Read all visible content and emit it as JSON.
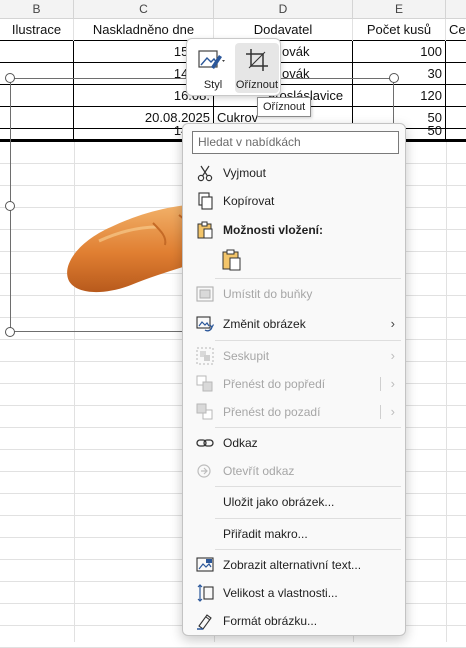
{
  "spreadsheet": {
    "columns": [
      "B",
      "C",
      "D",
      "E"
    ],
    "header_row": [
      "Ilustrace",
      "Naskladněno dne",
      "Dodavatel",
      "Počet kusů",
      "Ce"
    ],
    "rows": [
      {
        "date": "15.08.",
        "supplier": "ovák",
        "count": "100"
      },
      {
        "date": "14.08.",
        "supplier": "ovák",
        "count": "30"
      },
      {
        "date": "16.08.",
        "supplier": "arosláslavice",
        "count": "120"
      },
      {
        "date": "20.08.2025",
        "supplier": "Cukrov",
        "count": "50"
      },
      {
        "date": "14.08.",
        "supplier": "",
        "count": "50"
      }
    ]
  },
  "mini_toolbar": {
    "style_label": "Styl",
    "crop_label": "Oříznout",
    "tooltip": "Oříznout"
  },
  "context_menu": {
    "search_placeholder": "Hledat v nabídkách",
    "cut": "Vyjmout",
    "copy": "Kopírovat",
    "paste_options": "Možnosti vložení:",
    "place_in_cell": "Umístit do buňky",
    "change_picture": "Změnit obrázek",
    "group": "Seskupit",
    "bring_forward": "Přenést do popředí",
    "send_backward": "Přenést do pozadí",
    "link": "Odkaz",
    "open_link": "Otevřít odkaz",
    "save_as_picture": "Uložit jako obrázek...",
    "assign_macro": "Přiřadit makro...",
    "alt_text": "Zobrazit alternativní text...",
    "size_properties": "Velikost a vlastnosti...",
    "format_picture": "Formát obrázku..."
  },
  "colors": {
    "accent": "#2b579a",
    "disabled_text": "#a6a6a6",
    "bread": "#e08a3a"
  }
}
